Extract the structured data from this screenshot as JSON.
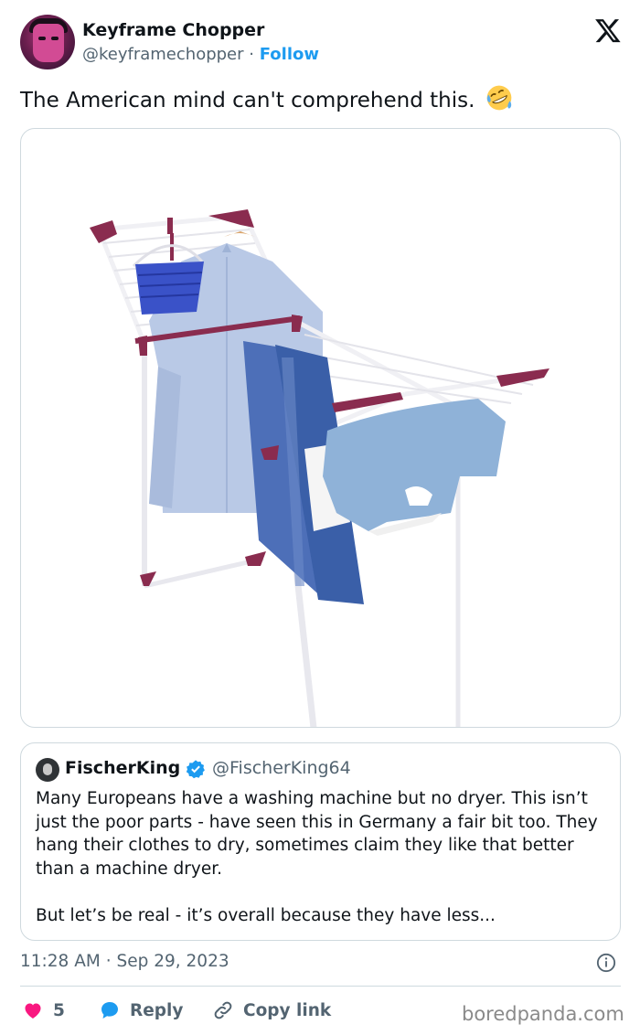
{
  "author": {
    "display_name": "Keyframe Chopper",
    "handle": "@keyframechopper",
    "separator": "·",
    "follow_label": "Follow"
  },
  "tweet": {
    "text": "The American mind can't comprehend this.",
    "emoji": "rolling-on-floor-laughing-emoji"
  },
  "media": {
    "description_icon": "clothes-drying-rack-photo"
  },
  "quoted_tweet": {
    "display_name": "FischerKing",
    "verified": true,
    "handle": "@FischerKing64",
    "paragraph_1": "Many Europeans have a washing machine but no dryer. This isn’t just the poor parts - have seen this in Germany a fair bit too. They hang their clothes to dry, sometimes claim they like that better than a machine dryer.",
    "paragraph_2": "But let’s be real - it’s overall because they have less..."
  },
  "meta": {
    "time": "11:28 AM",
    "separator": "·",
    "date": "Sep 29, 2023"
  },
  "actions": {
    "like_count": "5",
    "reply_label": "Reply",
    "copy_link_label": "Copy link"
  },
  "watermark": "boredpanda.com",
  "colors": {
    "accent": "#1d9bf0",
    "like": "#f91880",
    "text": "#0f1419",
    "muted": "#536471",
    "border": "#cfd9de"
  }
}
